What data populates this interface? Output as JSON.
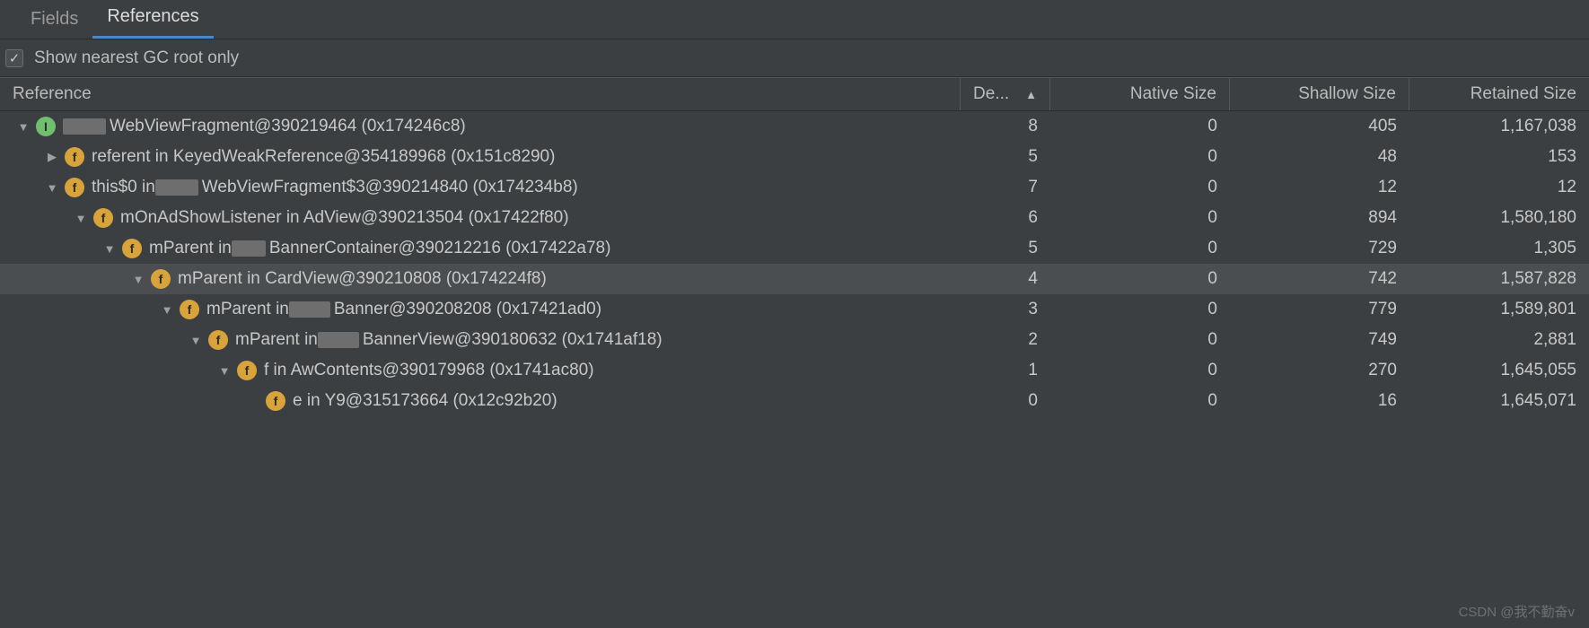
{
  "tabs": {
    "fields": "Fields",
    "references": "References"
  },
  "filter": {
    "label": "Show nearest GC root only",
    "checked": true
  },
  "columns": {
    "reference": "Reference",
    "depth": "De...",
    "native": "Native Size",
    "shallow": "Shallow Size",
    "retained": "Retained Size"
  },
  "rows": [
    {
      "indent": 0,
      "arrow": "down",
      "badge": "I",
      "redactW": 48,
      "label": "WebViewFragment@390219464 (0x174246c8)",
      "depth": "8",
      "native": "0",
      "shallow": "405",
      "retained": "1,167,038",
      "selected": false
    },
    {
      "indent": 1,
      "arrow": "right",
      "badge": "f",
      "redactW": 0,
      "label": "referent in KeyedWeakReference@354189968 (0x151c8290)",
      "depth": "5",
      "native": "0",
      "shallow": "48",
      "retained": "153",
      "selected": false
    },
    {
      "indent": 1,
      "arrow": "down",
      "badge": "f",
      "redactW": 48,
      "label_prefix": "this$0 in ",
      "label_suffix": "WebViewFragment$3@390214840 (0x174234b8)",
      "depth": "7",
      "native": "0",
      "shallow": "12",
      "retained": "12",
      "selected": false
    },
    {
      "indent": 2,
      "arrow": "down",
      "badge": "f",
      "redactW": 0,
      "label": "mOnAdShowListener in AdView@390213504 (0x17422f80)",
      "depth": "6",
      "native": "0",
      "shallow": "894",
      "retained": "1,580,180",
      "selected": false
    },
    {
      "indent": 3,
      "arrow": "down",
      "badge": "f",
      "redactW": 38,
      "label_prefix": "mParent in ",
      "label_suffix": "BannerContainer@390212216 (0x17422a78)",
      "depth": "5",
      "native": "0",
      "shallow": "729",
      "retained": "1,305",
      "selected": false
    },
    {
      "indent": 4,
      "arrow": "down",
      "badge": "f",
      "redactW": 0,
      "label": "mParent in CardView@390210808 (0x174224f8)",
      "depth": "4",
      "native": "0",
      "shallow": "742",
      "retained": "1,587,828",
      "selected": true
    },
    {
      "indent": 5,
      "arrow": "down",
      "badge": "f",
      "redactW": 46,
      "label_prefix": "mParent in  ",
      "label_suffix": "Banner@390208208 (0x17421ad0)",
      "depth": "3",
      "native": "0",
      "shallow": "779",
      "retained": "1,589,801",
      "selected": false
    },
    {
      "indent": 6,
      "arrow": "down",
      "badge": "f",
      "redactW": 46,
      "label_prefix": "mParent in   ",
      "label_suffix": "BannerView@390180632 (0x1741af18)",
      "depth": "2",
      "native": "0",
      "shallow": "749",
      "retained": "2,881",
      "selected": false
    },
    {
      "indent": 7,
      "arrow": "down",
      "badge": "f",
      "redactW": 0,
      "label": "f in AwContents@390179968 (0x1741ac80)",
      "depth": "1",
      "native": "0",
      "shallow": "270",
      "retained": "1,645,055",
      "selected": false
    },
    {
      "indent": 8,
      "arrow": "none",
      "badge": "f",
      "redactW": 0,
      "label": "e in Y9@315173664 (0x12c92b20)",
      "depth": "0",
      "native": "0",
      "shallow": "16",
      "retained": "1,645,071",
      "selected": false
    }
  ],
  "watermark": "CSDN @我不勤奋v"
}
